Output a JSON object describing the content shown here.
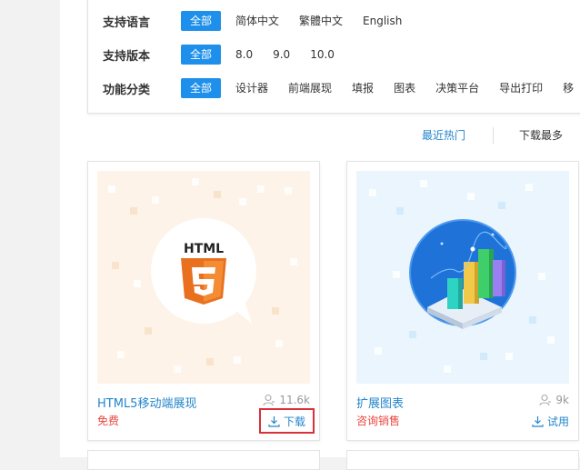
{
  "filters": [
    {
      "label": "支持语言",
      "options": [
        "全部",
        "简体中文",
        "繁體中文",
        "English"
      ],
      "active": 0
    },
    {
      "label": "支持版本",
      "options": [
        "全部",
        "8.0",
        "9.0",
        "10.0"
      ],
      "active": 0
    },
    {
      "label": "功能分类",
      "options": [
        "全部",
        "设计器",
        "前端展现",
        "填报",
        "图表",
        "决策平台",
        "导出打印",
        "移"
      ],
      "active": 0
    }
  ],
  "sort": {
    "recent_hot": "最近热门",
    "most_downloads": "下载最多"
  },
  "cards": [
    {
      "title": "HTML5移动端展现",
      "price": "免费",
      "count": "11.6k",
      "action": "下载",
      "thumb_text": "HTML"
    },
    {
      "title": "扩展图表",
      "price": "咨询销售",
      "count": "9k",
      "action": "试用"
    }
  ],
  "colors": {
    "accent": "#1e8fea",
    "link": "#2486cc",
    "price": "#e8473f",
    "html5": "#e8701f"
  }
}
